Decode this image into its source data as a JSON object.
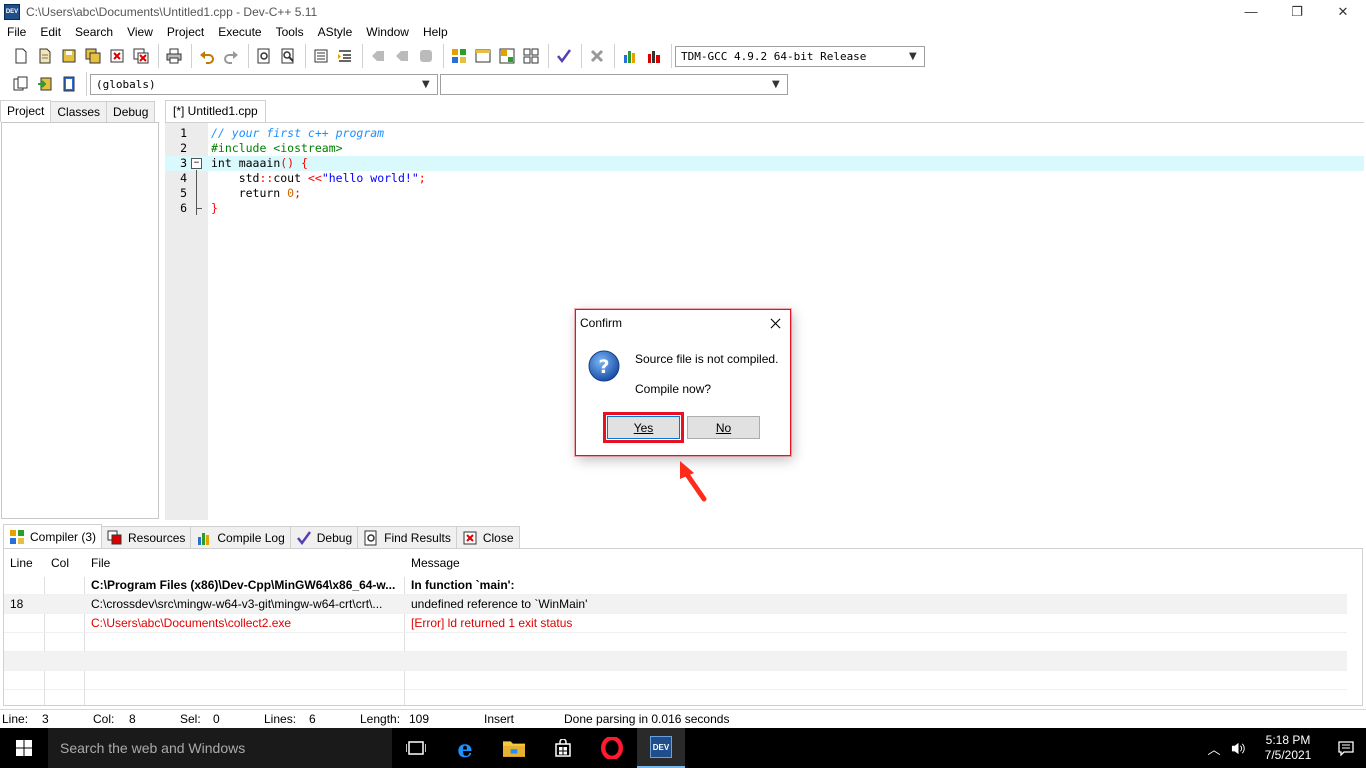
{
  "window": {
    "title": "C:\\Users\\abc\\Documents\\Untitled1.cpp - Dev-C++ 5.11",
    "app_icon_text": "DEV",
    "minimize": "—",
    "restore": "❐",
    "close": "✕"
  },
  "menu": [
    "File",
    "Edit",
    "Search",
    "View",
    "Project",
    "Execute",
    "Tools",
    "AStyle",
    "Window",
    "Help"
  ],
  "toolbar": {
    "compiler_select": "TDM-GCC 4.9.2 64-bit Release",
    "scope_select": "(globals)",
    "member_select": ""
  },
  "left_panel": {
    "tabs": [
      "Project",
      "Classes",
      "Debug"
    ],
    "active_tab": "Project"
  },
  "editor": {
    "tab_label": "[*] Untitled1.cpp",
    "line_numbers": [
      "1",
      "2",
      "3",
      "4",
      "5",
      "6"
    ],
    "lines": {
      "l1": "// your first c++ program",
      "l2": "#include <iostream>",
      "l3_kw": "int",
      "l3_name": " maaain",
      "l3_sym": "() {",
      "l4_a": "    std",
      "l4_b": "::",
      "l4_c": "cout ",
      "l4_d": "<<",
      "l4_e": "\"hello world!\"",
      "l4_f": ";",
      "l5_a": "    return ",
      "l5_b": "0",
      "l5_c": ";",
      "l6": "}"
    }
  },
  "bottom_panel": {
    "tabs": [
      "Compiler (3)",
      "Resources",
      "Compile Log",
      "Debug",
      "Find Results",
      "Close"
    ],
    "columns": [
      "Line",
      "Col",
      "File",
      "Message"
    ],
    "rows": [
      {
        "line": "",
        "col": "",
        "file": "C:\\Program Files (x86)\\Dev-Cpp\\MinGW64\\x86_64-w...",
        "message": "In function `main':"
      },
      {
        "line": "18",
        "col": "",
        "file": "C:\\crossdev\\src\\mingw-w64-v3-git\\mingw-w64-crt\\crt\\...",
        "message": "undefined reference to `WinMain'"
      },
      {
        "line": "",
        "col": "",
        "file": "C:\\Users\\abc\\Documents\\collect2.exe",
        "message": "[Error] ld returned 1 exit status"
      }
    ]
  },
  "status": {
    "line_label": "Line:",
    "line_val": "3",
    "col_label": "Col:",
    "col_val": "8",
    "sel_label": "Sel:",
    "sel_val": "0",
    "lines_label": "Lines:",
    "lines_val": "6",
    "length_label": "Length:",
    "length_val": "109",
    "mode": "Insert",
    "message": "Done parsing in 0.016 seconds"
  },
  "dialog": {
    "title": "Confirm",
    "message1": "Source file is not compiled.",
    "message2": "Compile now?",
    "yes_label": "Yes",
    "no_label": "No",
    "accent": "#e81123"
  },
  "taskbar": {
    "search_placeholder": "Search the web and Windows",
    "time": "5:18 PM",
    "date": "7/5/2021",
    "devcpp_icon_text": "DEV"
  }
}
